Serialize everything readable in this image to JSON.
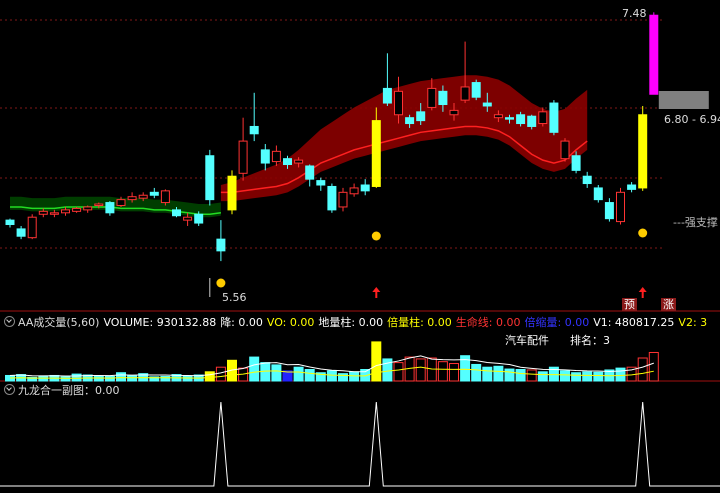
{
  "colors": {
    "up": "#ff3333",
    "down": "#54ffff",
    "yellow": "#ffff00",
    "magenta": "#ff00ff",
    "green": "#00cc00",
    "darkgreen": "#004400",
    "darkred": "#8b0000",
    "gray": "#808080",
    "separator": "#a01010"
  },
  "main_panel": {
    "price_top_label": "7.48",
    "price_range_label": "6.80 - 6.94",
    "low_label": "5.56",
    "support_label": "---强支撑",
    "tag_pre": "预",
    "tag_rise": "涨"
  },
  "volume_panel": {
    "indicator_name": "AA成交量(5,60)",
    "volume": "VOLUME: 930132.88",
    "fall": "降: 0.00",
    "vo": "VO: 0.00",
    "ground_bar": "地量柱: 0.00",
    "multiple_bar": "倍量柱: 0.00",
    "life_line": "生命线: 0.00",
    "shrink": "倍缩量: 0.00",
    "v1": "V1: 480817.25",
    "v2": "V2: 3",
    "sector": "汽车配件",
    "rank": "排名：3"
  },
  "sub_panel": {
    "title": "九龙合一副图：0.00"
  },
  "chart_data": [
    {
      "type": "candlestick",
      "title": "",
      "candles": [
        {
          "o": 6.05,
          "c": 6.08,
          "h": 6.09,
          "l": 6.03,
          "color": "down"
        },
        {
          "o": 6.02,
          "c": 5.97,
          "h": 6.04,
          "l": 5.95,
          "color": "down"
        },
        {
          "o": 5.96,
          "c": 6.1,
          "h": 6.12,
          "l": 5.95,
          "color": "up"
        },
        {
          "o": 6.12,
          "c": 6.14,
          "h": 6.16,
          "l": 6.1,
          "color": "up"
        },
        {
          "o": 6.12,
          "c": 6.13,
          "h": 6.15,
          "l": 6.1,
          "color": "up"
        },
        {
          "o": 6.13,
          "c": 6.15,
          "h": 6.17,
          "l": 6.11,
          "color": "up"
        },
        {
          "o": 6.14,
          "c": 6.16,
          "h": 6.17,
          "l": 6.13,
          "color": "up"
        },
        {
          "o": 6.15,
          "c": 6.17,
          "h": 6.18,
          "l": 6.13,
          "color": "up"
        },
        {
          "o": 6.18,
          "c": 6.19,
          "h": 6.2,
          "l": 6.16,
          "color": "up"
        },
        {
          "o": 6.2,
          "c": 6.13,
          "h": 6.21,
          "l": 6.11,
          "color": "down"
        },
        {
          "o": 6.18,
          "c": 6.22,
          "h": 6.24,
          "l": 6.17,
          "color": "up"
        },
        {
          "o": 6.22,
          "c": 6.24,
          "h": 6.27,
          "l": 6.2,
          "color": "up"
        },
        {
          "o": 6.23,
          "c": 6.25,
          "h": 6.27,
          "l": 6.21,
          "color": "up"
        },
        {
          "o": 6.25,
          "c": 6.27,
          "h": 6.3,
          "l": 6.23,
          "color": "down"
        },
        {
          "o": 6.28,
          "c": 6.2,
          "h": 6.29,
          "l": 6.18,
          "color": "up"
        },
        {
          "o": 6.15,
          "c": 6.11,
          "h": 6.17,
          "l": 6.1,
          "color": "down"
        },
        {
          "o": 6.1,
          "c": 6.08,
          "h": 6.13,
          "l": 6.04,
          "color": "up"
        },
        {
          "o": 6.12,
          "c": 6.06,
          "h": 6.14,
          "l": 6.04,
          "color": "down"
        },
        {
          "o": 6.52,
          "c": 6.22,
          "h": 6.56,
          "l": 6.18,
          "color": "down"
        },
        {
          "o": 5.95,
          "c": 5.87,
          "h": 6.08,
          "l": 5.8,
          "color": "down"
        },
        {
          "o": 6.15,
          "c": 6.38,
          "h": 6.42,
          "l": 6.12,
          "color": "yellow"
        },
        {
          "o": 6.4,
          "c": 6.62,
          "h": 6.78,
          "l": 6.35,
          "color": "up"
        },
        {
          "o": 6.67,
          "c": 6.72,
          "h": 6.95,
          "l": 6.62,
          "color": "down"
        },
        {
          "o": 6.56,
          "c": 6.47,
          "h": 6.6,
          "l": 6.42,
          "color": "down"
        },
        {
          "o": 6.48,
          "c": 6.55,
          "h": 6.59,
          "l": 6.45,
          "color": "up"
        },
        {
          "o": 6.5,
          "c": 6.46,
          "h": 6.52,
          "l": 6.43,
          "color": "down"
        },
        {
          "o": 6.47,
          "c": 6.49,
          "h": 6.51,
          "l": 6.44,
          "color": "up"
        },
        {
          "o": 6.45,
          "c": 6.36,
          "h": 6.46,
          "l": 6.31,
          "color": "down"
        },
        {
          "o": 6.35,
          "c": 6.32,
          "h": 6.37,
          "l": 6.28,
          "color": "down"
        },
        {
          "o": 6.31,
          "c": 6.15,
          "h": 6.33,
          "l": 6.13,
          "color": "down"
        },
        {
          "o": 6.17,
          "c": 6.27,
          "h": 6.3,
          "l": 6.14,
          "color": "up"
        },
        {
          "o": 6.26,
          "c": 6.3,
          "h": 6.33,
          "l": 6.24,
          "color": "up"
        },
        {
          "o": 6.32,
          "c": 6.28,
          "h": 6.36,
          "l": 6.25,
          "color": "down"
        },
        {
          "o": 6.31,
          "c": 6.76,
          "h": 6.85,
          "l": 6.3,
          "color": "yellow"
        },
        {
          "o": 6.98,
          "c": 6.88,
          "h": 7.22,
          "l": 6.86,
          "color": "down"
        },
        {
          "o": 6.8,
          "c": 6.96,
          "h": 7.06,
          "l": 6.74,
          "color": "up"
        },
        {
          "o": 6.78,
          "c": 6.74,
          "h": 6.8,
          "l": 6.71,
          "color": "down"
        },
        {
          "o": 6.76,
          "c": 6.82,
          "h": 6.88,
          "l": 6.73,
          "color": "down"
        },
        {
          "o": 6.85,
          "c": 6.98,
          "h": 7.05,
          "l": 6.83,
          "color": "up"
        },
        {
          "o": 6.96,
          "c": 6.87,
          "h": 7,
          "l": 6.82,
          "color": "down"
        },
        {
          "o": 6.8,
          "c": 6.83,
          "h": 6.88,
          "l": 6.76,
          "color": "up"
        },
        {
          "o": 6.9,
          "c": 6.99,
          "h": 7.3,
          "l": 6.88,
          "color": "up"
        },
        {
          "o": 7.02,
          "c": 6.92,
          "h": 7.04,
          "l": 6.9,
          "color": "down"
        },
        {
          "o": 6.88,
          "c": 6.86,
          "h": 6.95,
          "l": 6.82,
          "color": "down"
        },
        {
          "o": 6.8,
          "c": 6.78,
          "h": 6.83,
          "l": 6.75,
          "color": "up"
        },
        {
          "o": 6.77,
          "c": 6.78,
          "h": 6.8,
          "l": 6.74,
          "color": "down"
        },
        {
          "o": 6.74,
          "c": 6.8,
          "h": 6.82,
          "l": 6.72,
          "color": "down"
        },
        {
          "o": 6.79,
          "c": 6.72,
          "h": 6.8,
          "l": 6.7,
          "color": "down"
        },
        {
          "o": 6.74,
          "c": 6.82,
          "h": 6.85,
          "l": 6.72,
          "color": "up"
        },
        {
          "o": 6.88,
          "c": 6.68,
          "h": 6.9,
          "l": 6.66,
          "color": "down"
        },
        {
          "o": 6.62,
          "c": 6.5,
          "h": 6.64,
          "l": 6.48,
          "color": "up"
        },
        {
          "o": 6.52,
          "c": 6.42,
          "h": 6.55,
          "l": 6.4,
          "color": "down"
        },
        {
          "o": 6.38,
          "c": 6.33,
          "h": 6.41,
          "l": 6.3,
          "color": "down"
        },
        {
          "o": 6.3,
          "c": 6.22,
          "h": 6.32,
          "l": 6.2,
          "color": "down"
        },
        {
          "o": 6.2,
          "c": 6.09,
          "h": 6.23,
          "l": 6.07,
          "color": "down"
        },
        {
          "o": 6.07,
          "c": 6.27,
          "h": 6.3,
          "l": 6.05,
          "color": "up"
        },
        {
          "o": 6.32,
          "c": 6.29,
          "h": 6.34,
          "l": 6.27,
          "color": "down"
        },
        {
          "o": 6.3,
          "c": 6.8,
          "h": 6.86,
          "l": 6.28,
          "color": "yellow"
        },
        {
          "o": 6.94,
          "c": 7.48,
          "h": 7.5,
          "l": 6.94,
          "color": "magenta"
        }
      ],
      "ma_green": [
        6.17,
        6.17,
        6.16,
        6.16,
        6.16,
        6.17,
        6.17,
        6.17,
        6.17,
        6.17,
        6.16,
        6.16,
        6.16,
        6.15,
        6.15,
        6.14,
        6.13,
        6.12,
        6.12,
        6.13
      ],
      "ma_red": [
        6.27,
        6.27,
        6.28,
        6.29,
        6.3,
        6.31,
        6.33,
        6.37,
        6.42,
        6.47,
        6.5,
        6.53,
        6.56,
        6.58,
        6.6,
        6.62,
        6.64,
        6.66,
        6.68,
        6.69,
        6.7,
        6.71,
        6.72,
        6.72,
        6.71,
        6.69,
        6.65,
        6.59,
        6.53,
        6.49,
        6.47,
        6.49,
        6.56,
        6.62
      ],
      "ylim": [
        5.5,
        7.55
      ]
    },
    {
      "type": "bar",
      "title": "",
      "values": [
        12,
        14,
        8,
        11,
        12,
        9,
        15,
        13,
        11,
        10,
        18,
        12,
        16,
        9,
        10,
        14,
        11,
        13,
        20,
        30,
        45,
        28,
        52,
        40,
        35,
        22,
        30,
        25,
        18,
        22,
        16,
        20,
        25,
        85,
        48,
        40,
        52,
        48,
        50,
        42,
        38,
        55,
        36,
        30,
        32,
        26,
        25,
        24,
        20,
        30,
        22,
        18,
        20,
        19,
        24,
        28,
        30,
        50,
        62
      ],
      "colors": [
        "down",
        "down",
        "down",
        "down",
        "down",
        "down",
        "down",
        "down",
        "down",
        "down",
        "down",
        "down",
        "down",
        "down",
        "down",
        "down",
        "down",
        "down",
        "yellow",
        "up",
        "yellow",
        "up",
        "down",
        "down",
        "down",
        "blue",
        "down",
        "down",
        "down",
        "down",
        "down",
        "down",
        "down",
        "yellow",
        "down",
        "up",
        "up",
        "up",
        "up",
        "up",
        "up",
        "down",
        "down",
        "down",
        "down",
        "down",
        "down",
        "up",
        "down",
        "down",
        "down",
        "down",
        "down",
        "down",
        "down",
        "down",
        "up",
        "up",
        "up"
      ],
      "ylim": [
        0,
        100
      ]
    },
    {
      "type": "line",
      "title": "",
      "spikes": [
        19,
        33,
        57
      ],
      "ylim": [
        0,
        1
      ]
    }
  ]
}
